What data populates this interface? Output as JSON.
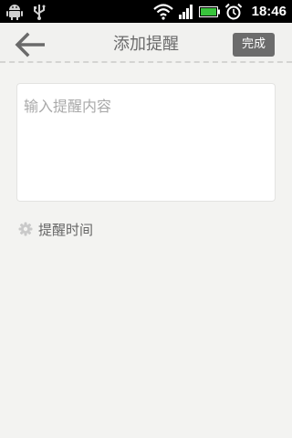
{
  "status_bar": {
    "time": "18:46",
    "icons": [
      "android-icon",
      "usb-icon",
      "wifi-icon",
      "signal-icon",
      "battery-icon",
      "alarm-icon"
    ]
  },
  "header": {
    "back_icon": "back-arrow-icon",
    "title": "添加提醒",
    "done_label": "完成"
  },
  "form": {
    "content_placeholder": "输入提醒内容",
    "content_value": ""
  },
  "reminder_time": {
    "icon": "gear-icon",
    "label": "提醒时间"
  },
  "colors": {
    "background": "#f3f3f1",
    "status_bar": "#000000",
    "done_button": "#6c6c6c",
    "title_text": "#6b6b6b",
    "battery": "#39c43c"
  }
}
